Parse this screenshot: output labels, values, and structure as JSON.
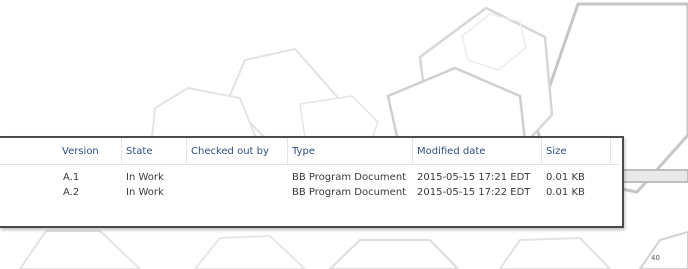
{
  "table": {
    "columns": [
      "Version",
      "State",
      "Checked out by",
      "Type",
      "Modified date",
      "Size"
    ],
    "rows": [
      [
        "A.1",
        "In Work",
        "",
        "BB Program Document",
        "2015-05-15 17:21 EDT",
        "0.01 KB"
      ],
      [
        "A.2",
        "In Work",
        "",
        "BB Program Document",
        "2015-05-15 17:22 EDT",
        "0.01 KB"
      ]
    ]
  },
  "slide": {
    "page_number": "40"
  },
  "colors": {
    "header_text": "#2e4e86",
    "cell_text": "#3a3a3a",
    "panel_border": "#4a4a4a"
  }
}
